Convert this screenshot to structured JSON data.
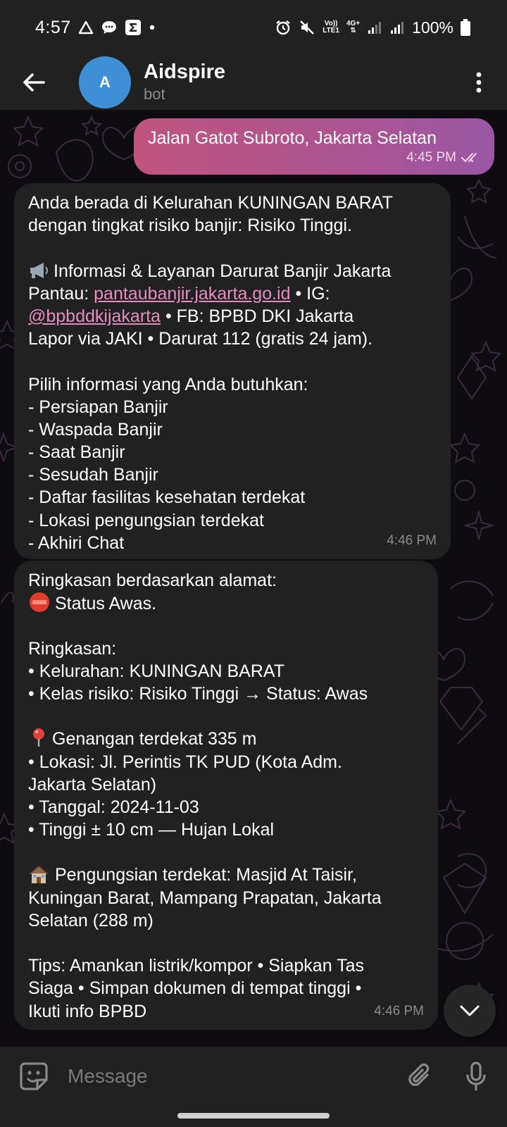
{
  "status_bar": {
    "time": "4:57",
    "network_top": "Vo))",
    "network_bottom": "LTE1",
    "data_top": "4G+",
    "data_bottom": "⇅",
    "battery": "100%"
  },
  "header": {
    "avatar_letter": "A",
    "title": "Aidspire",
    "subtitle": "bot",
    "avatar_color": "#3f8fd6"
  },
  "messages": {
    "outgoing": {
      "text": "Jalan Gatot Subroto, Jakarta Selatan",
      "time": "4:45 PM"
    },
    "bot_1": {
      "l1": "Anda berada di Kelurahan KUNINGAN BARAT",
      "l2": "dengan tingkat risiko banjir: Risiko Tinggi.",
      "l4": "Informasi & Layanan Darurat Banjir Jakarta",
      "l5_a": "Pantau: ",
      "l5_link": "pantaubanjir.jakarta.go.id",
      "l5_b": " • IG:",
      "l6_link": "@bpbddkijakarta",
      "l6_b": " • FB: BPBD DKI Jakarta",
      "l7": "Lapor via JAKI • Darurat 112 (gratis 24 jam).",
      "l9": "Pilih informasi yang Anda butuhkan:",
      "l10": "- Persiapan Banjir",
      "l11": "- Waspada Banjir",
      "l12": "- Saat Banjir",
      "l13": "- Sesudah Banjir",
      "l14": "- Daftar fasilitas kesehatan terdekat",
      "l15": "- Lokasi pengungsian terdekat",
      "l16": "- Akhiri Chat",
      "time": "4:46 PM"
    },
    "bot_2": {
      "l1": "Ringkasan berdasarkan alamat:",
      "l2": "Status Awas.",
      "l4": "Ringkasan:",
      "l5": "• Kelurahan: KUNINGAN BARAT",
      "l6": "• Kelas risiko: Risiko Tinggi → Status: Awas",
      "l8": "Genangan terdekat 335 m",
      "l9": "• Lokasi: Jl. Perintis TK PUD (Kota Adm.",
      "l10": "Jakarta Selatan)",
      "l11": "• Tanggal: 2024-11-03",
      "l12": "• Tinggi ± 10 cm — Hujan Lokal",
      "l14": "Pengungsian terdekat: Masjid At Taisir,",
      "l15": "Kuningan Barat, Mampang Prapatan, Jakarta",
      "l16": "Selatan (288 m)",
      "l18": "Tips: Amankan listrik/kompor • Siapkan Tas",
      "l19": "Siaga • Simpan dokumen di tempat tinggi •",
      "l20": "Ikuti info BPBD",
      "time": "4:46 PM"
    }
  },
  "composer": {
    "placeholder": "Message"
  },
  "colors": {
    "outgoing_start": "#c0557e",
    "outgoing_end": "#9a57a4",
    "incoming_bg": "#212121",
    "link": "#e68cc0"
  },
  "icons": {
    "back": "arrow-left-icon",
    "menu": "more-vertical-icon",
    "emoji": "sticker-smile-icon",
    "attach": "paperclip-icon",
    "mic": "microphone-icon",
    "scroll_down": "chevron-down-icon",
    "megaphone": "megaphone-icon",
    "stop": "stop-sign-icon",
    "pin": "round-pushpin-icon",
    "house": "house-icon",
    "read": "double-check-icon"
  }
}
